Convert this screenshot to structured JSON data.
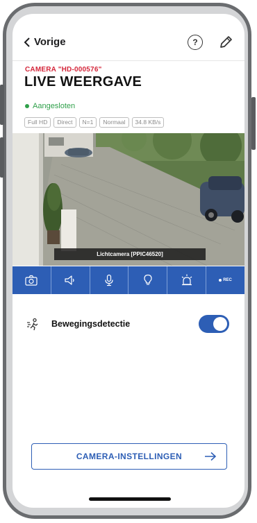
{
  "nav": {
    "back_label": "Vorige",
    "help_glyph": "?",
    "help_icon": "question-circle-icon",
    "edit_icon": "pencil-icon"
  },
  "camera": {
    "id_label": "CAMERA \"HD-000576\"",
    "title": "LIVE WEERGAVE"
  },
  "status": {
    "text": "Aangesloten",
    "color": "#2fa04a"
  },
  "stream_chips": [
    "Full HD",
    "Direct",
    "N=1",
    "Normaal",
    "34.8 KB/s"
  ],
  "feed": {
    "overlay_label": "Lichtcamera [PPIC46520]"
  },
  "toolbar": {
    "buttons": [
      {
        "icon": "snapshot-camera-icon"
      },
      {
        "icon": "speaker-icon"
      },
      {
        "icon": "microphone-icon"
      },
      {
        "icon": "light-bulb-icon"
      },
      {
        "icon": "siren-icon"
      },
      {
        "icon": "record-icon",
        "label": "REC"
      }
    ]
  },
  "motion": {
    "label": "Bewegingsdetectie",
    "enabled": true,
    "icon": "motion-detection-icon"
  },
  "settings_button": {
    "label": "CAMERA-INSTELLINGEN",
    "icon": "arrow-right-icon"
  },
  "colors": {
    "accent": "#2d5eb5",
    "camera_id": "#d4263a"
  }
}
